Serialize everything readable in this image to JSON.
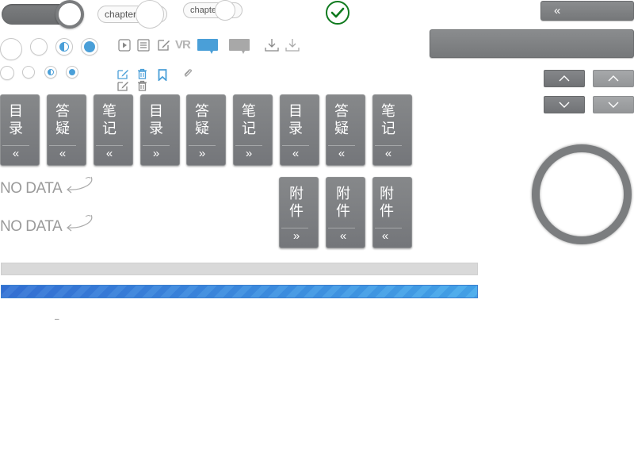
{
  "toggle": {
    "label": ""
  },
  "chips": {
    "chapter_large": "chapter",
    "chapter_small": "chapter"
  },
  "icons": {
    "check": "check-icon",
    "play": "play-icon",
    "list": "list-icon",
    "edit": "edit-icon",
    "vr": "VR",
    "chat_active": "chat-bubble-icon",
    "chat_inactive": "chat-bubble-icon",
    "download_dark": "download-icon",
    "download_light": "download-icon",
    "edit_blue": "edit-icon",
    "trash_blue": "trash-icon",
    "bookmark_blue": "bookmark-icon",
    "paperclip": "paperclip-icon"
  },
  "panel": {
    "collapse_arrow": "«"
  },
  "tabs": [
    {
      "label": "目录",
      "arrow": "«"
    },
    {
      "label": "答疑",
      "arrow": "«"
    },
    {
      "label": "笔记",
      "arrow": "«"
    },
    {
      "label": "目录",
      "arrow": "»"
    },
    {
      "label": "答疑",
      "arrow": "»"
    },
    {
      "label": "笔记",
      "arrow": "»"
    },
    {
      "label": "目录",
      "arrow": "«"
    },
    {
      "label": "答疑",
      "arrow": "«"
    },
    {
      "label": "笔记",
      "arrow": "«"
    }
  ],
  "attach_tabs": [
    {
      "label": "附件",
      "arrow": "»"
    },
    {
      "label": "附件",
      "arrow": "«"
    },
    {
      "label": "附件",
      "arrow": "«"
    }
  ],
  "empty_states": {
    "first": "NO DATA",
    "second": "NO DATA"
  },
  "progress": {
    "grey_fill": 0,
    "blue_fill": 1.0
  },
  "misc": {
    "dash": "–"
  },
  "colors": {
    "accent_blue": "#4a9fd8",
    "tab_grey": "#7d7f81",
    "check_green": "#0f7a1e"
  }
}
